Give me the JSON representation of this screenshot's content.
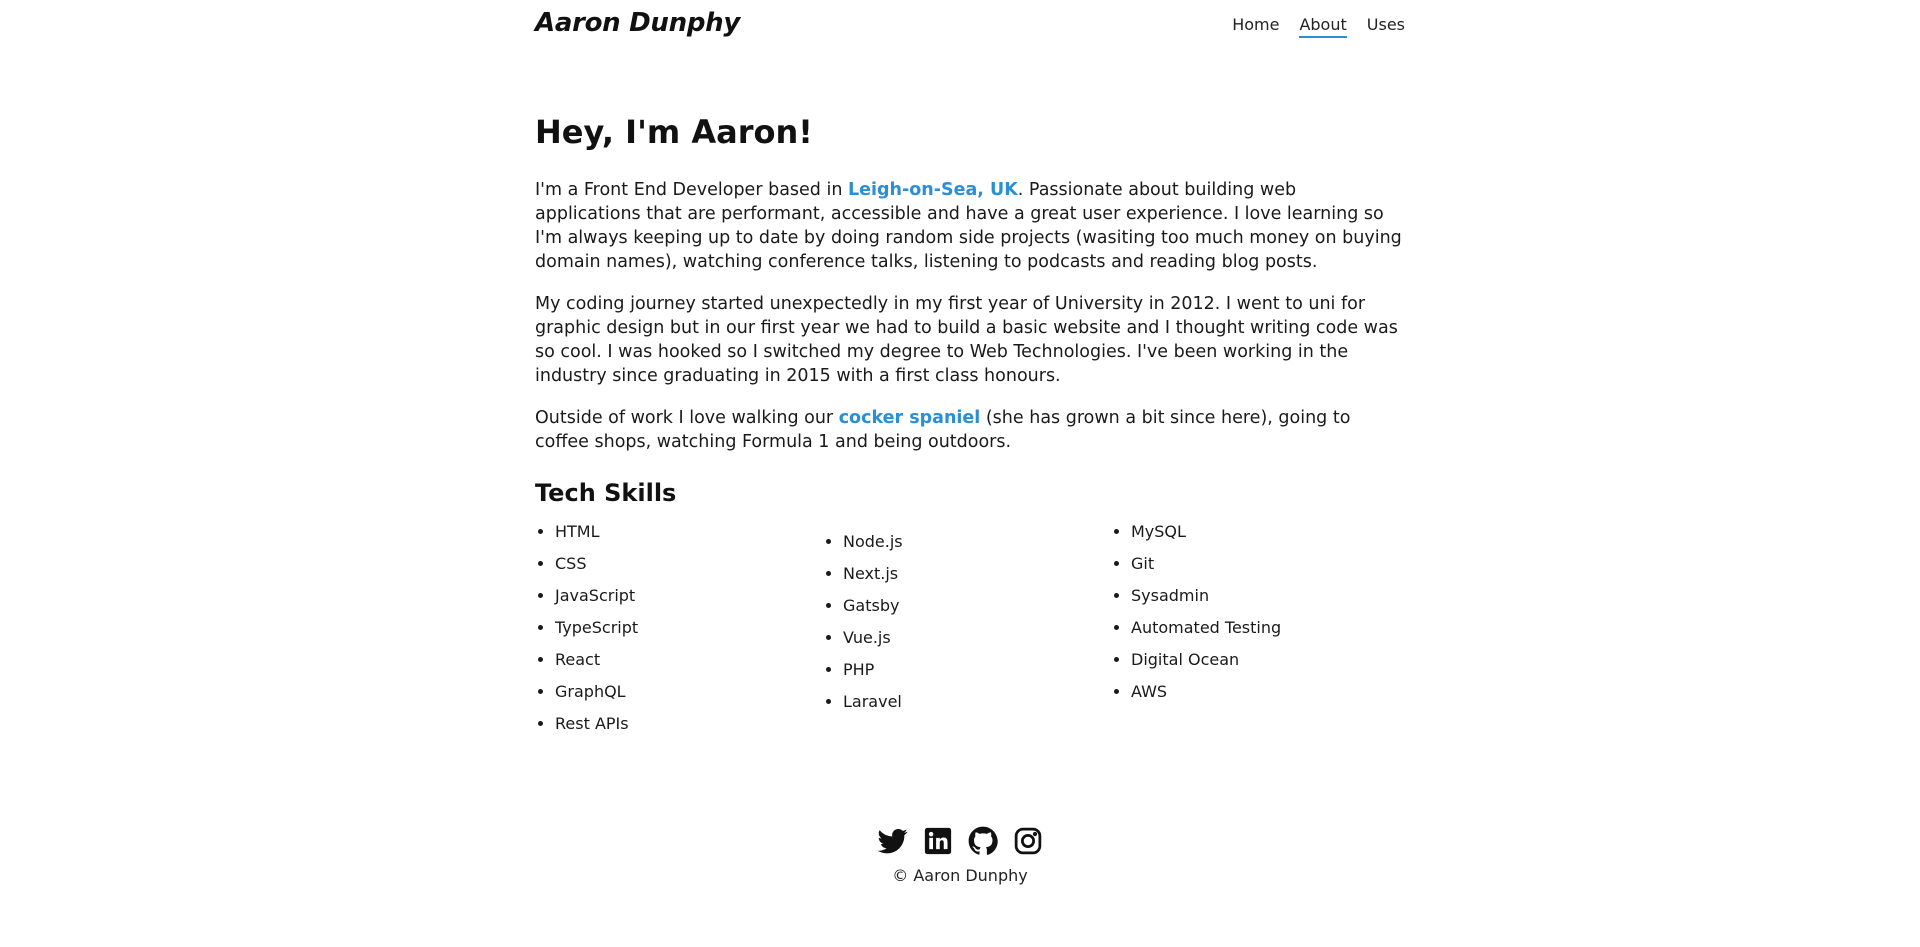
{
  "header": {
    "logo": "Aaron Dunphy",
    "nav": [
      {
        "label": "Home"
      },
      {
        "label": "About"
      },
      {
        "label": "Uses"
      }
    ]
  },
  "main": {
    "title": "Hey, I'm Aaron!",
    "para1": {
      "before": "I'm a Front End Developer based in ",
      "link": "Leigh-on-Sea, UK",
      "after": ". Passionate about building web applications that are performant, accessible and have a great user experience. I love learning so I'm always keeping up to date by doing random side projects (wasiting too much money on buying domain names), watching conference talks, listening to podcasts and reading blog posts."
    },
    "para2": "My coding journey started unexpectedly in my first year of University in 2012. I went to uni for graphic design but in our first year we had to build a basic website and I thought writing code was so cool. I was hooked so I switched my degree to Web Technologies. I've been working in the industry since graduating in 2015 with a first class honours.",
    "para3": {
      "before": "Outside of work I love walking our ",
      "link": "cocker spaniel",
      "after": " (she has grown a bit since here), going to coffee shops, watching Formula 1 and being outdoors."
    },
    "skills_title": "Tech Skills",
    "skills": [
      [
        "HTML",
        "CSS",
        "JavaScript",
        "TypeScript",
        "React",
        "GraphQL",
        "Rest APIs"
      ],
      [
        "Node.js",
        "Next.js",
        "Gatsby",
        "Vue.js",
        "PHP",
        "Laravel"
      ],
      [
        "MySQL",
        "Git",
        "Sysadmin",
        "Automated Testing",
        "Digital Ocean",
        "AWS"
      ]
    ]
  },
  "footer": {
    "socials": [
      "twitter-icon",
      "linkedin-icon",
      "github-icon",
      "instagram-icon"
    ],
    "copyright": "© Aaron Dunphy"
  },
  "colors": {
    "accent": "#2a8fd4",
    "text": "#111111"
  }
}
